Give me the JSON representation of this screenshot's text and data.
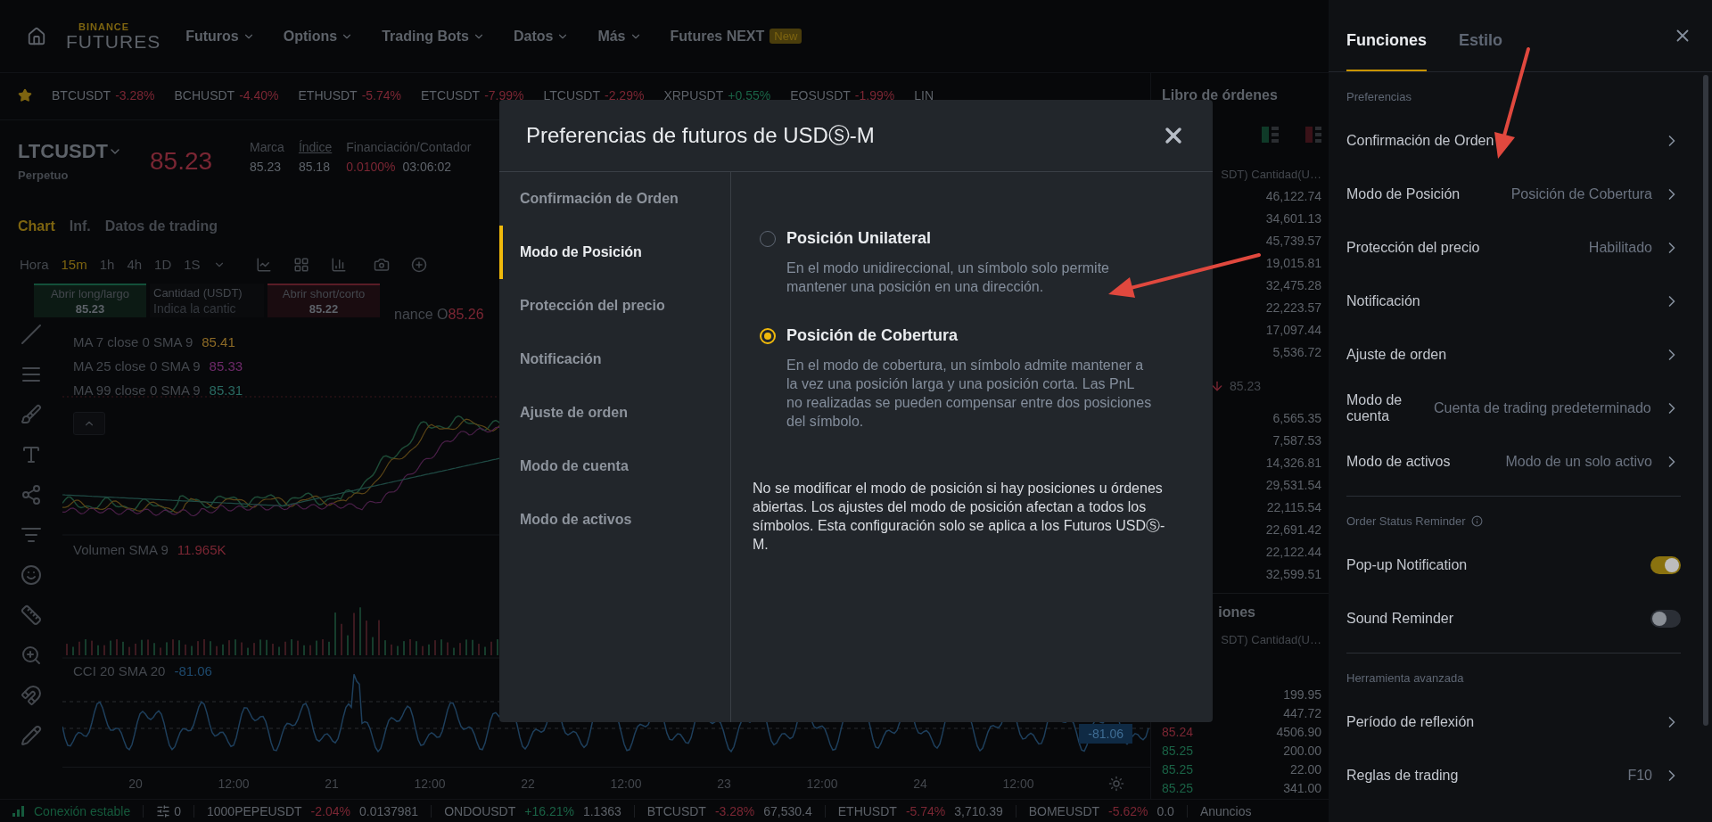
{
  "top_nav": {
    "logo": {
      "top": "BINANCE",
      "bottom": "FUTURES"
    },
    "items": [
      {
        "label": "Futuros"
      },
      {
        "label": "Options"
      },
      {
        "label": "Trading Bots"
      },
      {
        "label": "Datos"
      },
      {
        "label": "Más"
      }
    ],
    "next": {
      "label": "Futures NEXT",
      "badge": "New"
    }
  },
  "ticker": [
    {
      "symbol": "BTCUSDT",
      "change": "-3.28%",
      "color": "#7a2633"
    },
    {
      "symbol": "BCHUSDT",
      "change": "-4.40%",
      "color": "#7a2633"
    },
    {
      "symbol": "ETHUSDT",
      "change": "-5.74%",
      "color": "#7a2633"
    },
    {
      "symbol": "ETCUSDT",
      "change": "-7.99%",
      "color": "#7a2633"
    },
    {
      "symbol": "LTCUSDT",
      "change": "-2.29%",
      "color": "#7a2633"
    },
    {
      "symbol": "XRPUSDT",
      "change": "+0.55%",
      "color": "#1a6346"
    },
    {
      "symbol": "EOSUSDT",
      "change": "-1.99%",
      "color": "#7a2633"
    },
    {
      "symbol": "LIN"
    }
  ],
  "symbol_header": {
    "symbol": "LTCUSDT",
    "type": "Perpetuo",
    "last_price": "85.23",
    "stats": [
      {
        "label": "Marca",
        "value": "85.23"
      },
      {
        "label": "Índice",
        "value": "85.18"
      },
      {
        "label": "Financiación/Contador",
        "value": "0.0100%",
        "countdown": "03:06:02"
      }
    ]
  },
  "chart_tabs": [
    {
      "label": "Chart",
      "selected": true
    },
    {
      "label": "Inf.",
      "selected": false
    },
    {
      "label": "Datos de trading",
      "selected": false
    }
  ],
  "intervals": [
    {
      "label": "Hora",
      "selected": false
    },
    {
      "label": "15m",
      "selected": true
    },
    {
      "label": "1h",
      "selected": false
    },
    {
      "label": "4h",
      "selected": false
    },
    {
      "label": "1D",
      "selected": false
    },
    {
      "label": "1S",
      "selected": false
    }
  ],
  "order_widget": {
    "long": {
      "label": "Abrir long/largo",
      "price": "85.23"
    },
    "amount": {
      "label": "Cantidad (USDT)",
      "placeholder": "Indica la cantic"
    },
    "short": {
      "label": "Abrir short/corto",
      "price": "85.22"
    }
  },
  "price_source": {
    "text": "nance O",
    "value": "85.26"
  },
  "chart_legend": [
    {
      "text": "MA 7 close 0 SMA 9",
      "value": "85.41",
      "color": "#8c6a26"
    },
    {
      "text": "MA 25 close 0 SMA 9",
      "value": "85.33",
      "color": "#6e2a6a"
    },
    {
      "text": "MA 99 close 0 SMA 9",
      "value": "85.31",
      "color": "#2a6a62"
    }
  ],
  "volume_legend": {
    "text": "Volumen SMA 9",
    "value": "11.965K"
  },
  "cci_legend": {
    "text": "CCI 20 SMA 20",
    "value": "-81.06"
  },
  "cci_price_tag": "-81.06",
  "x_axis": [
    "20",
    "12:00",
    "21",
    "12:00",
    "22",
    "12:00",
    "23",
    "12:00",
    "24",
    "12:00"
  ],
  "orderbook": {
    "title": "Libro de órdenes",
    "column_header": "SDT) Cantidad(U…",
    "asks": [
      "46,122.74",
      "34,601.13",
      "45,739.57",
      "19,015.81",
      "32,475.28",
      "22,223.57",
      "17,097.44",
      "5,536.72"
    ],
    "mid_price": "85.23",
    "bids": [
      "6,565.35",
      "7,587.53",
      "14,326.81",
      "29,531.54",
      "22,115.54",
      "22,691.42",
      "22,122.44",
      "32,599.51"
    ]
  },
  "trades": {
    "title": "iones",
    "column_header": "SDT) Cantidad(U…",
    "rows": [
      {
        "amount": "199.95"
      },
      {
        "amount": "447.72"
      },
      {
        "price": "85.24",
        "amount": "4506.90",
        "color": "#7a2633"
      },
      {
        "price": "85.25",
        "amount": "200.00",
        "color": "#1a6346"
      },
      {
        "price": "85.25",
        "amount": "22.00",
        "color": "#1a6346"
      },
      {
        "price": "85.25",
        "amount": "341.00",
        "color": "#1a6346"
      }
    ]
  },
  "status_bar": {
    "connection": "Conexión estable",
    "filter_count": "0",
    "tickers": [
      {
        "symbol": "1000PEPEUSDT",
        "change": "-2.04%",
        "price": "0.0137981",
        "color": "#7a2633"
      },
      {
        "symbol": "ONDOUSDT",
        "change": "+16.21%",
        "price": "1.1363",
        "color": "#1a6346"
      },
      {
        "symbol": "BTCUSDT",
        "change": "-3.28%",
        "price": "67,530.4",
        "color": "#7a2633"
      },
      {
        "symbol": "ETHUSDT",
        "change": "-5.74%",
        "price": "3,710.39",
        "color": "#7a2633"
      },
      {
        "symbol": "BOMEUSDT",
        "change": "-5.62%",
        "price": "0.0",
        "color": "#7a2633"
      }
    ],
    "announcements": "Anuncios"
  },
  "modal": {
    "title": "Preferencias de futuros de USDⓈ-M",
    "nav": [
      {
        "label": "Confirmación de Orden",
        "selected": false
      },
      {
        "label": "Modo de Posición",
        "selected": true
      },
      {
        "label": "Protección del precio",
        "selected": false
      },
      {
        "label": "Notificación",
        "selected": false
      },
      {
        "label": "Ajuste de orden",
        "selected": false
      },
      {
        "label": "Modo de cuenta",
        "selected": false
      },
      {
        "label": "Modo de activos",
        "selected": false
      }
    ],
    "options": [
      {
        "label": "Posición Unilateral",
        "description": "En el modo unidireccional, un símbolo solo permite mantener una posición en una dirección.",
        "selected": false
      },
      {
        "label": "Posición de Cobertura",
        "description": "En el modo de cobertura, un símbolo admite mantener a la vez una posición larga y una posición corta. Las PnL no realizadas se pueden compensar entre dos posiciones del símbolo.",
        "selected": true
      }
    ],
    "note": "No se modificar el modo de posición si hay posiciones u órdenes abiertas. Los ajustes del modo de posición afectan a todos los símbolos. Esta configuración solo se aplica a los Futuros USDⓈ-M."
  },
  "settings_panel": {
    "tabs": [
      {
        "label": "Funciones",
        "selected": true
      },
      {
        "label": "Estilo",
        "selected": false
      }
    ],
    "sections": [
      {
        "title": "Preferencias",
        "rows": [
          {
            "kind": "link",
            "label": "Confirmación de Orden"
          },
          {
            "kind": "link",
            "label": "Modo de Posición",
            "value": "Posición de Cobertura"
          },
          {
            "kind": "link",
            "label": "Protección del precio",
            "value": "Habilitado"
          },
          {
            "kind": "link",
            "label": "Notificación"
          },
          {
            "kind": "link",
            "label": "Ajuste de orden"
          },
          {
            "kind": "link",
            "label": "Modo de cuenta",
            "value": "Cuenta de trading predeterminado"
          },
          {
            "kind": "link",
            "label": "Modo de activos",
            "value": "Modo de un solo activo"
          }
        ]
      },
      {
        "title": "Order Status Reminder",
        "info": true,
        "rows": [
          {
            "kind": "toggle",
            "label": "Pop-up Notification",
            "on": true
          },
          {
            "kind": "toggle",
            "label": "Sound Reminder",
            "on": false
          }
        ]
      },
      {
        "title": "Herramienta avanzada",
        "rows": [
          {
            "kind": "link",
            "label": "Período de reflexión"
          },
          {
            "kind": "link",
            "label": "Reglas de trading",
            "value": "F10"
          }
        ]
      }
    ]
  }
}
